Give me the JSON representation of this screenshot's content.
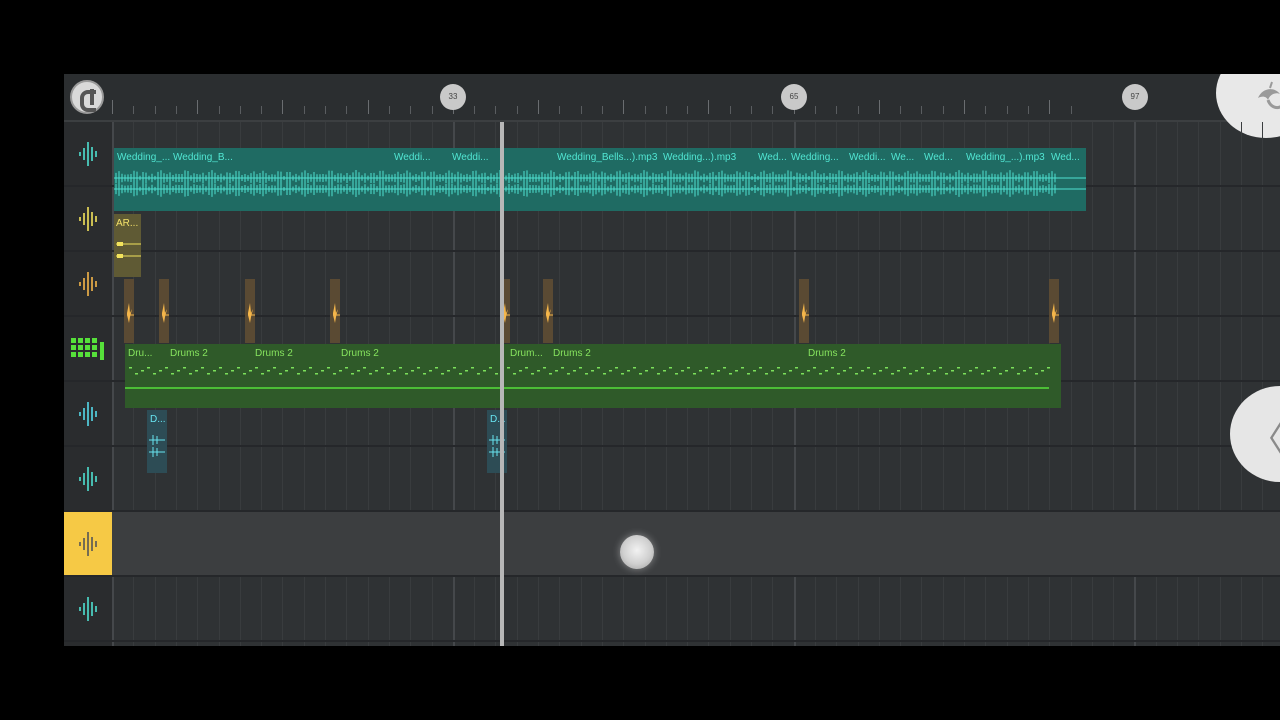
{
  "ruler": {
    "markers": [
      "33",
      "65",
      "97"
    ]
  },
  "tracks": [
    {
      "icon": "waveform-icon",
      "color": "#4fe0d0"
    },
    {
      "icon": "waveform-icon",
      "color": "#f2e35c"
    },
    {
      "icon": "waveform-icon",
      "color": "#f5b64a"
    },
    {
      "icon": "step-sequencer-icon",
      "color": "#56e03a"
    },
    {
      "icon": "waveform-icon",
      "color": "#55d9ea"
    },
    {
      "icon": "waveform-icon",
      "color": "#4fe0d0"
    },
    {
      "icon": "waveform-icon",
      "color": "#555555",
      "selected": true
    },
    {
      "icon": "waveform-icon",
      "color": "#4fe0d0"
    }
  ],
  "lanes": {
    "wedding_labels": [
      "Wedding_...",
      "Wedding_B...",
      "Weddi...",
      "Weddi...",
      "Wedding_Bells...).mp3",
      "Wedding...).mp3",
      "Wed...",
      "Wedding...",
      "Weddi...",
      "We...",
      "Wed...",
      "Wedding_...).mp3",
      "Wed..."
    ],
    "ar_label": "AR...",
    "drum_labels": [
      "Dru...",
      "Drums 2",
      "Drums 2",
      "Drums 2",
      "Drum...",
      "Drums 2",
      "Drums 2"
    ],
    "d_labels": [
      "D...",
      "D..."
    ]
  },
  "colors": {
    "audio_clip": "#1f6b63",
    "pattern_clip": "#2f5a29",
    "selected_track": "#f6c945"
  }
}
